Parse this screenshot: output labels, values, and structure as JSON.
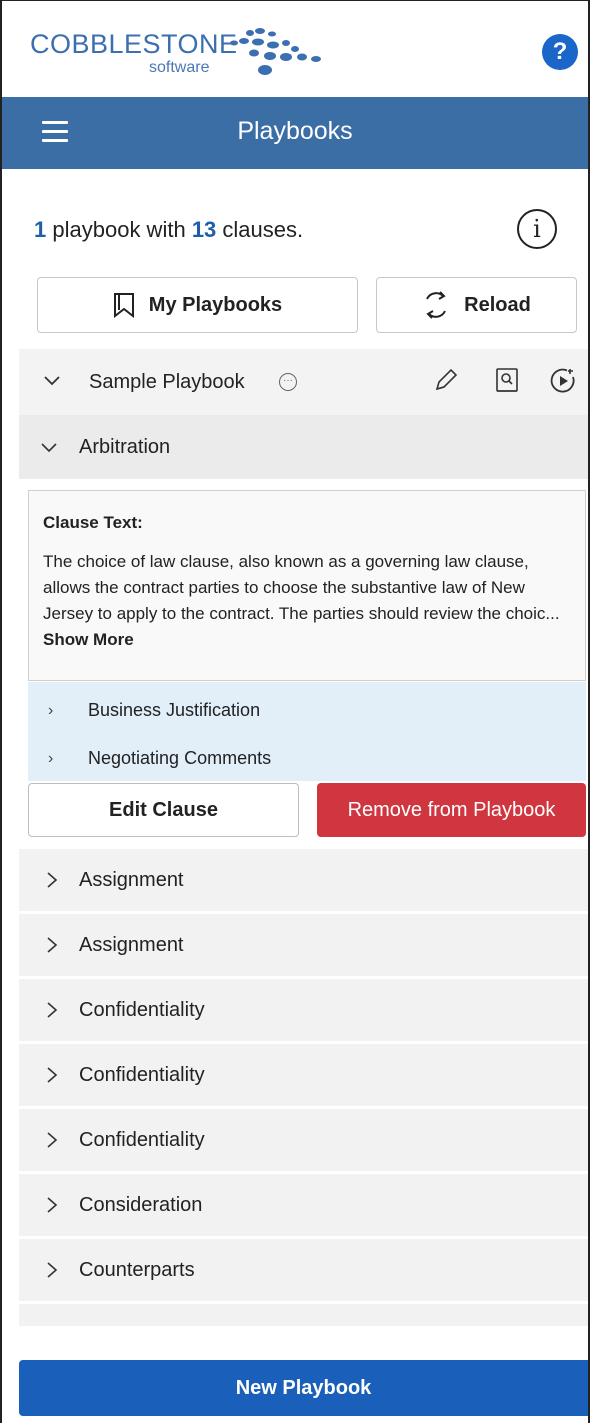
{
  "brand": {
    "name": "COBBLESTONE",
    "sub": "software",
    "colors": {
      "primary": "#3a6ea5",
      "button": "#1a60ba",
      "danger": "#d0363f",
      "help": "#1b66c9"
    }
  },
  "header": {
    "help_label": "?",
    "title": "Playbooks"
  },
  "summary": {
    "count": "1",
    "text1": "playbook with",
    "clauses": "13",
    "text2": "clauses."
  },
  "toolbar": {
    "my_playbooks": "My Playbooks",
    "reload": "Reload"
  },
  "playbook": {
    "name": "Sample Playbook",
    "expanded": true,
    "actions": [
      "pencil-icon",
      "book-search-icon",
      "play-icon"
    ]
  },
  "open_clause": {
    "name": "Arbitration",
    "text_heading": "Clause Text:",
    "text": "The choice of law clause, also known as a governing law clause, allows the contract parties to choose the substantive law of New Jersey to apply to the contract. The parties should review the choic...",
    "show_more": "Show More",
    "sections": [
      "Business Justification",
      "Negotiating Comments"
    ],
    "edit_label": "Edit Clause",
    "remove_label": "Remove from Playbook"
  },
  "clauses": [
    "Assignment",
    "Assignment",
    "Confidentiality",
    "Confidentiality",
    "Confidentiality",
    "Consideration",
    "Counterparts"
  ],
  "footer": {
    "new_playbook": "New Playbook"
  }
}
